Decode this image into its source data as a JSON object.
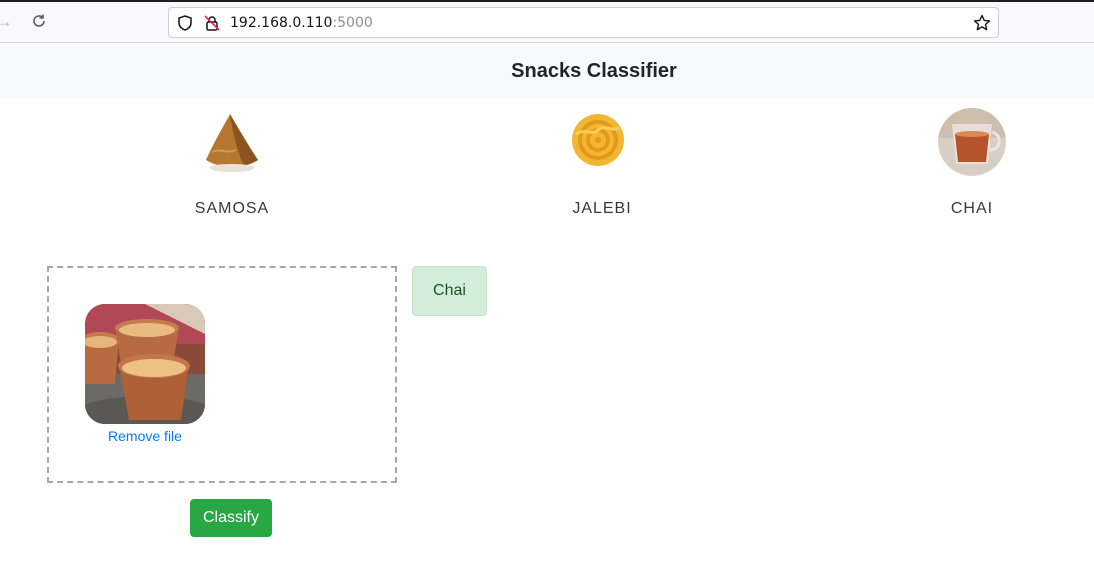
{
  "browser": {
    "url_host": "192.168.0.110",
    "url_port": ":5000"
  },
  "header": {
    "title": "Snacks Classifier"
  },
  "categories": [
    {
      "label": "SAMOSA",
      "icon": "samosa-image"
    },
    {
      "label": "JALEBI",
      "icon": "jalebi-image"
    },
    {
      "label": "CHAI",
      "icon": "chai-image"
    }
  ],
  "upload": {
    "remove_label": "Remove file",
    "preview_icon": "chai-cups-image"
  },
  "result": {
    "label": "Chai"
  },
  "actions": {
    "classify_label": "Classify"
  },
  "colors": {
    "header_bg": "#f8f9fa",
    "success_bg": "#d4edda",
    "success_text": "#155724",
    "button_green": "#28a745",
    "link_blue": "#007bff"
  }
}
